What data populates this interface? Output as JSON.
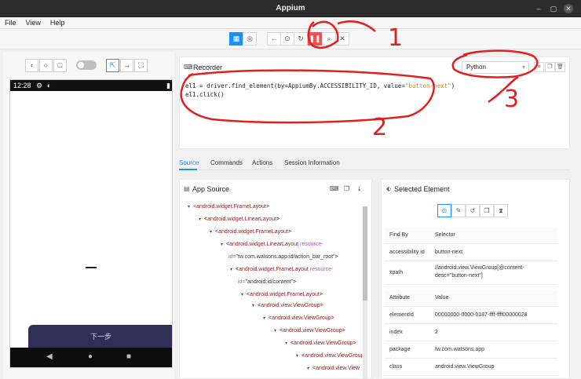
{
  "window": {
    "title": "Appium"
  },
  "menu": [
    "File",
    "View",
    "Help"
  ],
  "device": {
    "status_time": "12:28",
    "next_button_label": "下一步"
  },
  "recorder": {
    "title": "Recorder",
    "language": "Python",
    "code_line1_prefix": "el1 = driver.find_element(by=AppiumBy.ACCESSIBILITY_ID, value=",
    "code_line1_string": "\"button-next\"",
    "code_line1_suffix": ")",
    "code_line2": "el1.click()"
  },
  "tabs": [
    "Source",
    "Commands",
    "Actions",
    "Session Information"
  ],
  "source": {
    "title": "App Source",
    "nodes": [
      {
        "tag": "<android.widget.FrameLayout>"
      },
      {
        "tag": "<android.widget.LinearLayout>"
      },
      {
        "tag": "<android.widget.FrameLayout>"
      },
      {
        "tag": "<android.widget.LinearLayout",
        "attr": " resource-",
        "attr2": "id=",
        "val": "\"tw.com.watsons.app:id/action_bar_root\">"
      },
      {
        "tag": "<android.widget.FrameLayout",
        "attr": " resource-",
        "attr2": "id=",
        "val": "\"android:id/content\">"
      },
      {
        "tag": "<android.widget.FrameLayout>"
      },
      {
        "tag": "<android.view.ViewGroup>"
      },
      {
        "tag": "<android.view.ViewGroup>"
      },
      {
        "tag": "<android.view.ViewGroup>"
      },
      {
        "tag": "<android.view.ViewGroup>"
      },
      {
        "tag": "<android.view.ViewGroup>"
      },
      {
        "tag": "<android.view.View"
      }
    ]
  },
  "selected": {
    "title": "Selected Element",
    "find_by_header": "Find By",
    "selector_header": "Selector",
    "find_rows": [
      {
        "key": "accessibility id",
        "value": "button-next"
      },
      {
        "key": "xpath",
        "value": "//android.view.ViewGroup[@content-desc=\"button-next\"]"
      }
    ],
    "attribute_header": "Attribute",
    "value_header": "Value",
    "attr_rows": [
      {
        "key": "elementId",
        "value": "00000000-0000-0187-ffff-ffff00000028"
      },
      {
        "key": "index",
        "value": "2"
      },
      {
        "key": "package",
        "value": "tw.com.watsons.app"
      },
      {
        "key": "class",
        "value": "android.view.ViewGroup"
      }
    ]
  },
  "annotations": {
    "one": "1",
    "two": "2",
    "three": "3"
  },
  "colors": {
    "accent": "#1890ff",
    "pause": "#ff4d4f",
    "annotation": "#e02020",
    "device_button": "#2f2e54"
  }
}
